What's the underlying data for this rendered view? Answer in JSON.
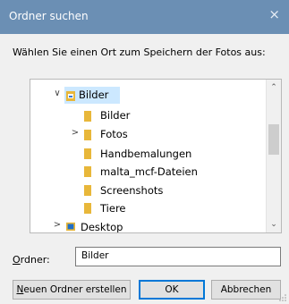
{
  "window": {
    "title": "Ordner suchen",
    "close_glyph": "×"
  },
  "prompt": "Wählen Sie einen Ort zum Speichern der Fotos aus:",
  "tree": {
    "items": [
      {
        "label": "Bilder",
        "chevron": "∨",
        "icon": "pictures-folder-icon"
      },
      {
        "label": "Bilder",
        "chevron": "",
        "icon": "folder-icon"
      },
      {
        "label": "Fotos",
        "chevron": ">",
        "icon": "folder-icon"
      },
      {
        "label": "Handbemalungen",
        "chevron": "",
        "icon": "folder-icon"
      },
      {
        "label": "malta_mcf-Dateien",
        "chevron": "",
        "icon": "folder-icon"
      },
      {
        "label": "Screenshots",
        "chevron": "",
        "icon": "folder-icon"
      },
      {
        "label": "Tiere",
        "chevron": "",
        "icon": "folder-icon"
      },
      {
        "label": "Desktop",
        "chevron": ">",
        "icon": "desktop-folder-icon"
      }
    ]
  },
  "folder_field": {
    "label_prefix": "O",
    "label_rest": "rdner:",
    "value": "Bilder"
  },
  "buttons": {
    "new_folder": {
      "underline": "N",
      "rest": "euen Ordner erstellen"
    },
    "ok": "OK",
    "cancel": "Abbrechen"
  },
  "colors": {
    "titlebar": "#6b8fb4",
    "selection": "#cce8ff",
    "folder": "#e8b73a",
    "accent": "#0078d7"
  }
}
